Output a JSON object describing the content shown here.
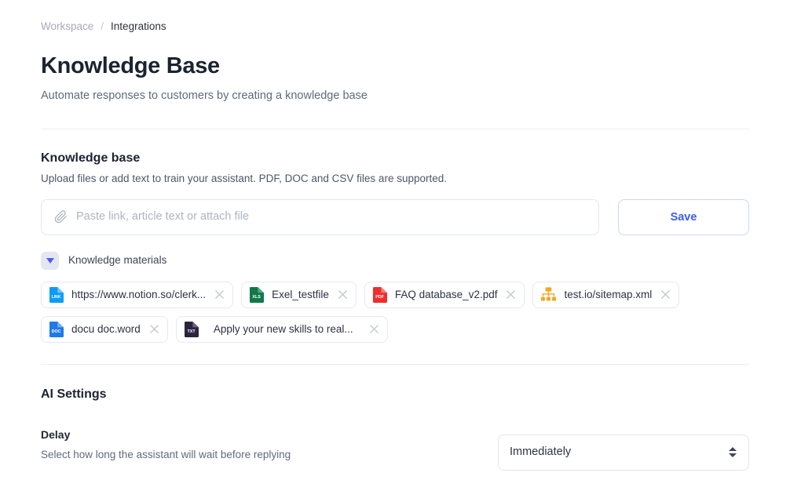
{
  "breadcrumb": {
    "parent": "Workspace",
    "separator": "/",
    "current": "Integrations"
  },
  "header": {
    "title": "Knowledge Base",
    "subtitle": "Automate responses to customers by creating a knowledge base"
  },
  "knowledge_base": {
    "section_title": "Knowledge base",
    "section_desc": "Upload files or add text to train your assistant. PDF, DOC and CSV files are supported.",
    "input_placeholder": "Paste link, article text or attach file",
    "input_value": "",
    "attach_icon": "paperclip-icon",
    "save_label": "Save",
    "materials_label": "Knowledge materials",
    "materials_toggle_icon": "chevron-down-icon",
    "chips": [
      {
        "label": "https://www.notion.so/clerk...",
        "icon": "link-file-icon",
        "icon_text": "LINK",
        "icon_color": "#0d9cf5",
        "close_icon": "close-icon"
      },
      {
        "label": "Exel_testfile",
        "icon": "xls-file-icon",
        "icon_text": "XLS",
        "icon_color": "#11784a",
        "close_icon": "close-icon"
      },
      {
        "label": "FAQ database_v2.pdf",
        "icon": "pdf-file-icon",
        "icon_text": "PDF",
        "icon_color": "#ee2d2d",
        "close_icon": "close-icon"
      },
      {
        "label": "test.io/sitemap.xml",
        "icon": "sitemap-icon",
        "icon_text": "",
        "icon_color": "#f5a623",
        "close_icon": "close-icon"
      },
      {
        "label": "docu doc.word",
        "icon": "doc-file-icon",
        "icon_text": "DOC",
        "icon_color": "#1e7ae8",
        "close_icon": "close-icon"
      },
      {
        "label": "Apply your new skills to real...",
        "icon": "txt-file-icon",
        "icon_text": "TXT",
        "icon_color": "#2b2440",
        "close_icon": "close-icon"
      }
    ]
  },
  "ai_settings": {
    "section_title": "AI Settings",
    "delay": {
      "label": "Delay",
      "description": "Select how long the assistant will wait before replying",
      "selected": "Immediately",
      "options": [
        "Immediately"
      ]
    }
  },
  "colors": {
    "accent": "#3b5bfd",
    "text_dark": "#1b2330",
    "text_muted": "#5f6b7e",
    "border": "#e3e7ee",
    "divider": "#eceef1"
  }
}
